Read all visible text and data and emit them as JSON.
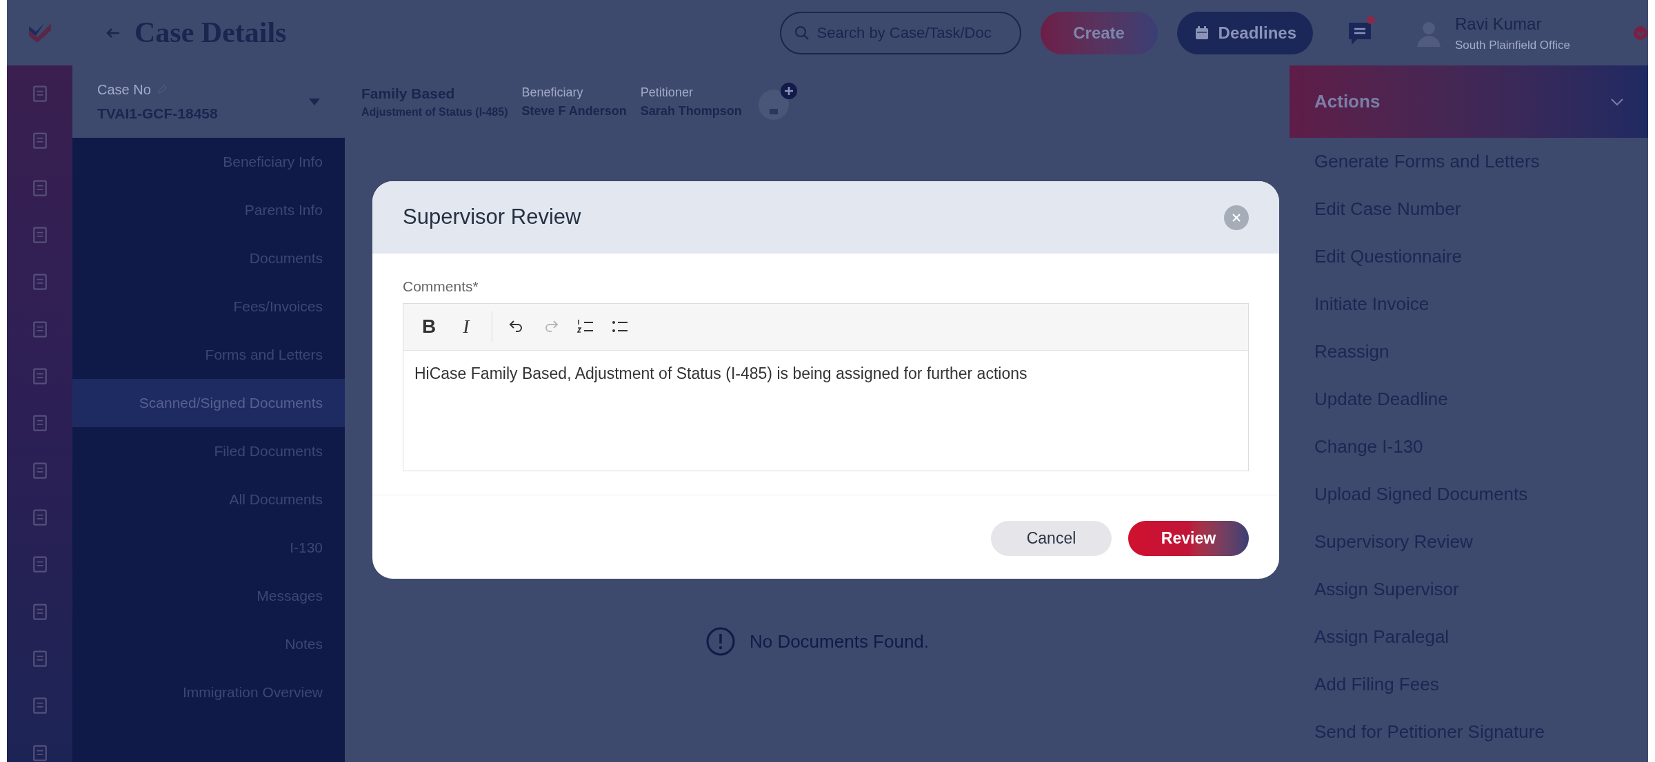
{
  "header": {
    "title": "Case Details",
    "search": {
      "placeholder": "Search by Case/Task/Doc"
    },
    "create_button": "Create",
    "deadlines_button": "Deadlines",
    "messages_unread": true,
    "user": {
      "name": "Ravi Kumar",
      "office": "South Plainfield Office"
    }
  },
  "case_bar": {
    "case_no_label": "Case No",
    "case_no": "TVAI1-GCF-18458",
    "case_type": "Family Based",
    "case_subtype": "Adjustment of Status (I-485)",
    "beneficiary_label": "Beneficiary",
    "beneficiary": "Steve F Anderson",
    "petitioner_label": "Petitioner",
    "petitioner": "Sarah Thompson"
  },
  "sidebar": {
    "items": [
      {
        "label": "Beneficiary Info",
        "selected": false
      },
      {
        "label": "Parents Info",
        "selected": false
      },
      {
        "label": "Documents",
        "selected": false
      },
      {
        "label": "Fees/Invoices",
        "selected": false
      },
      {
        "label": "Forms and Letters",
        "selected": false
      },
      {
        "label": "Scanned/Signed Documents",
        "selected": true
      },
      {
        "label": "Filed Documents",
        "selected": false
      },
      {
        "label": "All Documents",
        "selected": false
      },
      {
        "label": "I-130",
        "selected": false
      },
      {
        "label": "Messages",
        "selected": false
      },
      {
        "label": "Notes",
        "selected": false
      },
      {
        "label": "Immigration Overview",
        "selected": false
      }
    ]
  },
  "content": {
    "empty_message": "No Documents Found."
  },
  "actions": {
    "title": "Actions",
    "items": [
      "Generate Forms and Letters",
      "Edit Case Number",
      "Edit Questionnaire",
      "Initiate Invoice",
      "Reassign",
      "Update Deadline",
      "Change I-130",
      "Upload Signed Documents",
      "Supervisory Review",
      "Assign Supervisor",
      "Assign Paralegal",
      "Add Filing Fees",
      "Send for Petitioner Signature"
    ]
  },
  "modal": {
    "title": "Supervisor Review",
    "comments_label": "Comments*",
    "toolbar": [
      {
        "kind": "bold",
        "label": "B",
        "disabled": false
      },
      {
        "kind": "italic",
        "label": "I",
        "disabled": false
      },
      {
        "kind": "undo",
        "disabled": false
      },
      {
        "kind": "redo",
        "disabled": true
      },
      {
        "kind": "ordered_list",
        "disabled": false
      },
      {
        "kind": "bullet_list",
        "disabled": false
      }
    ],
    "comment": "HiCase Family Based, Adjustment of Status (I-485) is being assigned for further actions",
    "cancel_button": "Cancel",
    "review_button": "Review"
  }
}
